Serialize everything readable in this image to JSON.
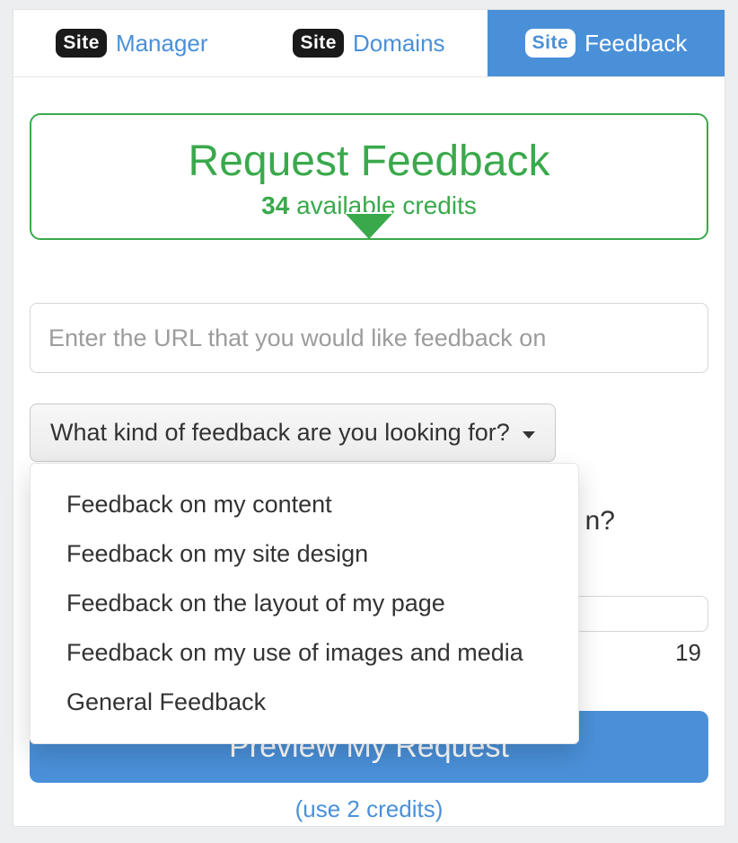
{
  "site_badge_text": "Site",
  "tabs": {
    "manager": "Manager",
    "domains": "Domains",
    "feedback": "Feedback"
  },
  "request_feedback": {
    "title": "Request Feedback",
    "credits_count": "34",
    "credits_label": "available credits"
  },
  "url_field": {
    "placeholder": "Enter the URL that you would like feedback on"
  },
  "dropdown": {
    "label": "What kind of feedback are you looking for?",
    "options": [
      "Feedback on my content",
      "Feedback on my site design",
      "Feedback on the layout of my page",
      "Feedback on my use of images and media",
      "General Feedback"
    ]
  },
  "hidden_question_tail": "n?",
  "char_count": "19",
  "preview_button": "Preview My Request",
  "use_credits": "(use 2 credits)"
}
